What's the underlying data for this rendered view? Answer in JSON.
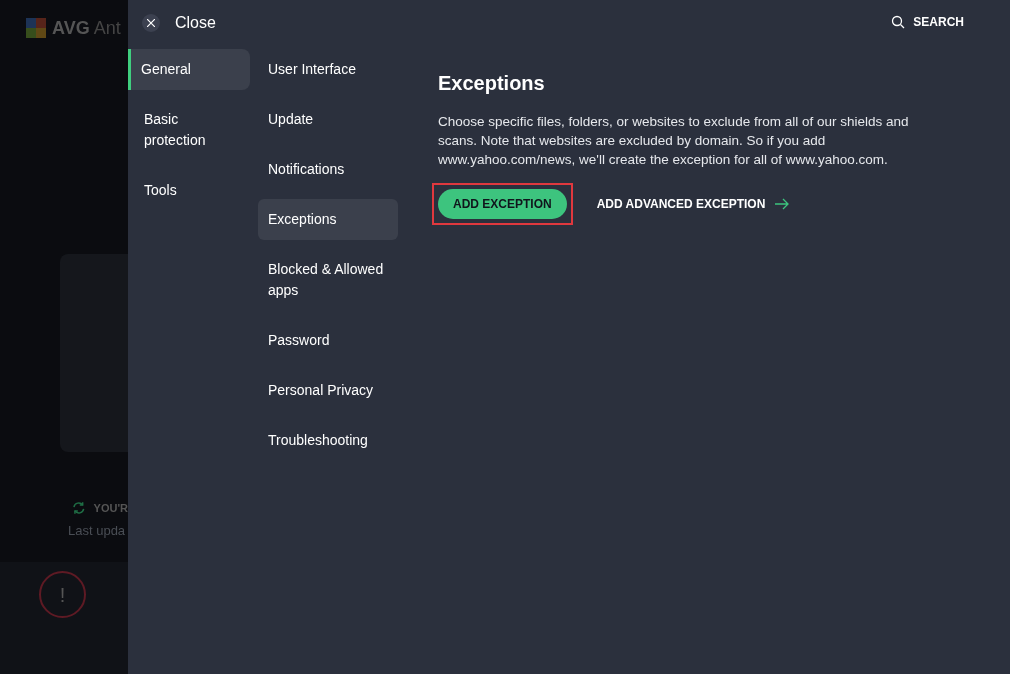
{
  "backdrop": {
    "logo_text": "AVG",
    "app_name": "Ant",
    "status": "YOU'R",
    "last_update": "Last upda",
    "alert_mark": "!"
  },
  "header": {
    "close_label": "Close",
    "search_label": "SEARCH"
  },
  "categories": [
    {
      "label": "General",
      "selected": true
    },
    {
      "label": "Basic protection",
      "selected": false
    },
    {
      "label": "Tools",
      "selected": false
    }
  ],
  "subcategories": [
    {
      "label": "User Interface",
      "selected": false
    },
    {
      "label": "Update",
      "selected": false
    },
    {
      "label": "Notifications",
      "selected": false
    },
    {
      "label": "Exceptions",
      "selected": true
    },
    {
      "label": "Blocked & Allowed apps",
      "selected": false
    },
    {
      "label": "Password",
      "selected": false
    },
    {
      "label": "Personal Privacy",
      "selected": false
    },
    {
      "label": "Troubleshooting",
      "selected": false
    }
  ],
  "content": {
    "title": "Exceptions",
    "description": "Choose specific files, folders, or websites to exclude from all of our shields and scans. Note that websites are excluded by domain. So if you add www.yahoo.com/news, we'll create the exception for all of www.yahoo.com.",
    "primary_button": {
      "label": "ADD EXCEPTION",
      "highlighted": true
    },
    "secondary_link": {
      "label": "ADD ADVANCED EXCEPTION"
    }
  }
}
